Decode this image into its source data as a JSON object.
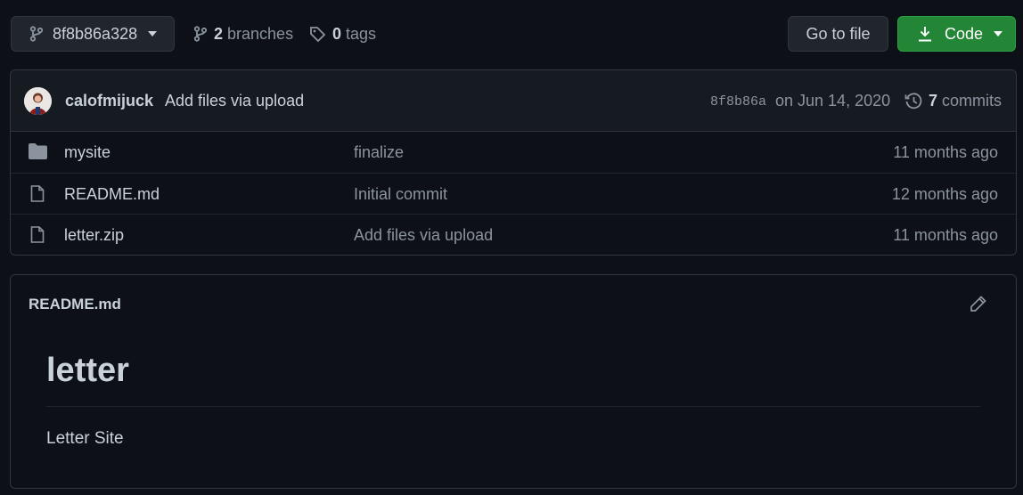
{
  "toolbar": {
    "branch_name": "8f8b86a328",
    "branches_count": "2",
    "branches_label": "branches",
    "tags_count": "0",
    "tags_label": "tags",
    "goto_label": "Go to file",
    "code_label": "Code"
  },
  "latest_commit": {
    "author": "calofmijuck",
    "message": "Add files via upload",
    "sha": "8f8b86a",
    "date": "on Jun 14, 2020",
    "commits_count": "7",
    "commits_label": "commits"
  },
  "files": [
    {
      "type": "folder",
      "name": "mysite",
      "commit": "finalize",
      "age": "11 months ago"
    },
    {
      "type": "file",
      "name": "README.md",
      "commit": "Initial commit",
      "age": "12 months ago"
    },
    {
      "type": "file",
      "name": "letter.zip",
      "commit": "Add files via upload",
      "age": "11 months ago"
    }
  ],
  "readme": {
    "filename": "README.md",
    "heading": "letter",
    "body": "Letter Site"
  },
  "colors": {
    "background": "#0d1117",
    "accent_green": "#238636",
    "text_muted": "#8b949e"
  },
  "icons": {
    "branch": "git-branch-icon",
    "tag": "tag-icon",
    "download": "download-icon",
    "history": "history-icon",
    "folder": "folder-icon",
    "file": "file-icon",
    "edit": "pencil-icon"
  }
}
